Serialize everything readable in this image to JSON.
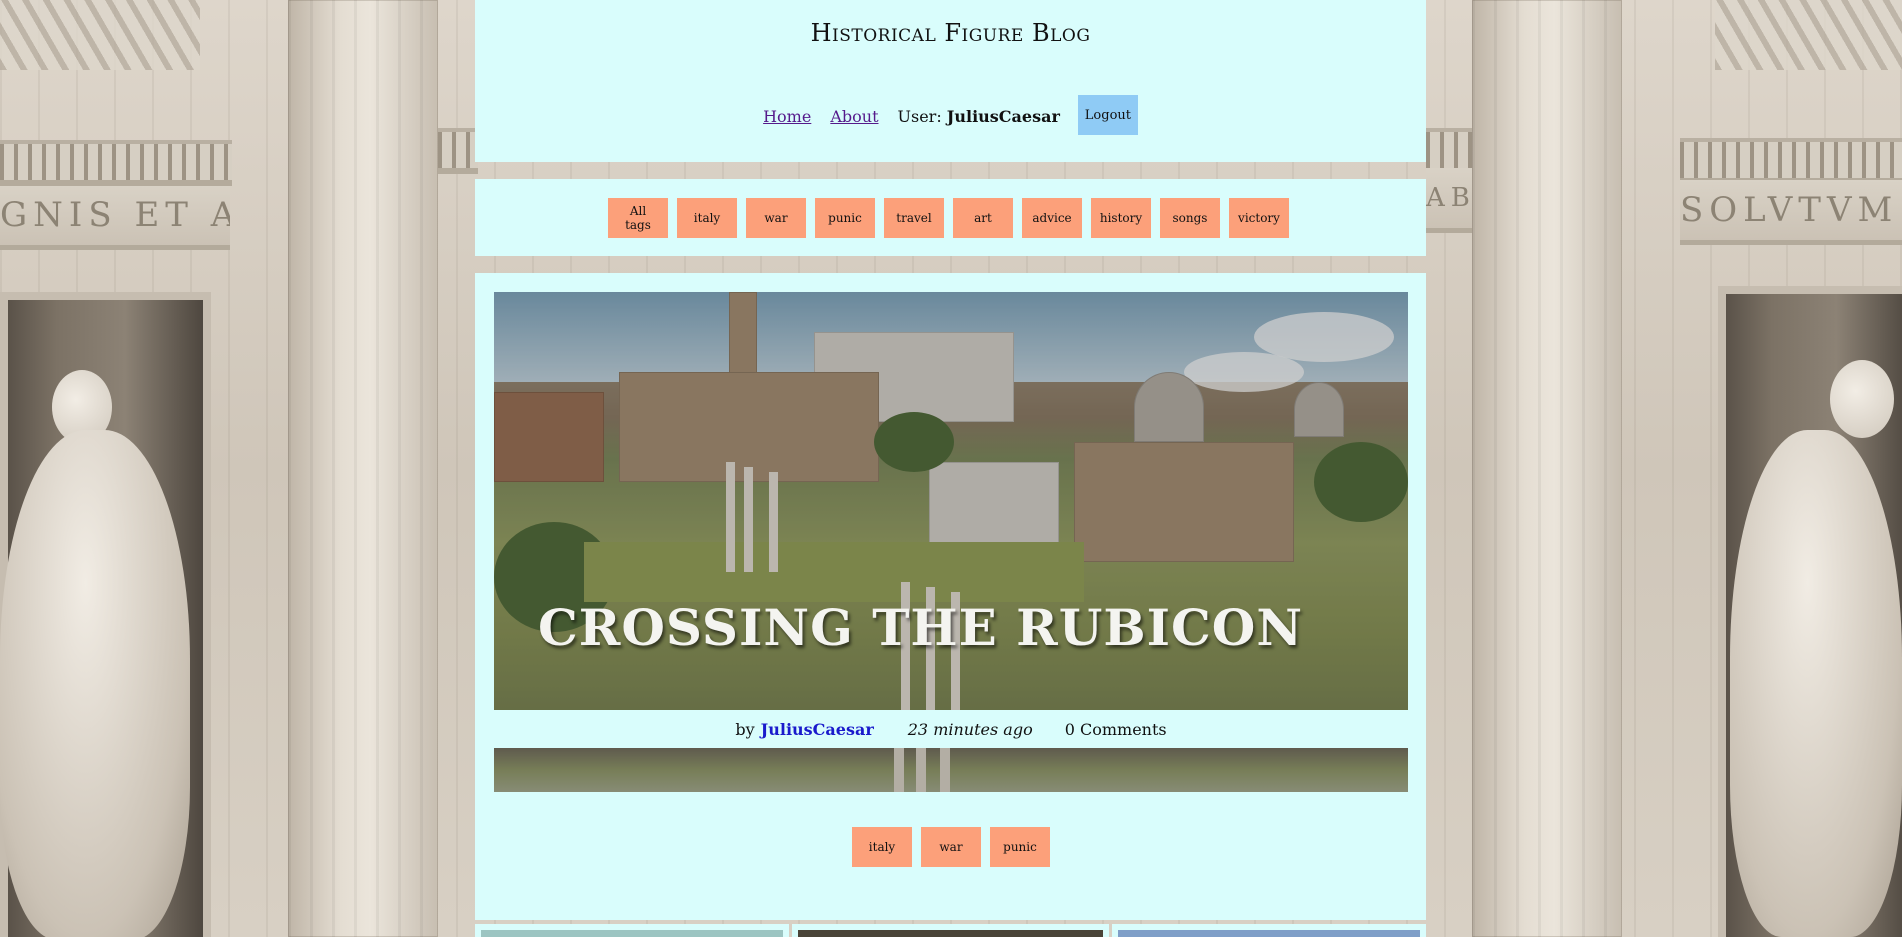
{
  "header": {
    "site_title": "Historical Figure Blog",
    "nav": {
      "home": "Home",
      "about": "About",
      "user_prefix": "User:",
      "username": "JuliusCaesar",
      "logout": "Logout"
    }
  },
  "tag_filter": {
    "tags": [
      "All tags",
      "italy",
      "war",
      "punic",
      "travel",
      "art",
      "advice",
      "history",
      "songs",
      "victory"
    ]
  },
  "post": {
    "title": "CROSSING THE RUBICON",
    "by_label": "by",
    "author": "JuliusCaesar",
    "time": "23 minutes ago",
    "comments": "0 Comments",
    "tags": [
      "italy",
      "war",
      "punic"
    ]
  },
  "background_text": {
    "left_inscription": "GNIS ET ANA",
    "right_inscription": "SOLVTVM A-DO",
    "center_inscription": "AB"
  },
  "colors": {
    "panel_bg": "#d9fdfc",
    "tag_bg": "#fca07a",
    "logout_bg": "#8fcbf5",
    "link_visited": "#551a8b",
    "author_link": "#1a1acc"
  }
}
